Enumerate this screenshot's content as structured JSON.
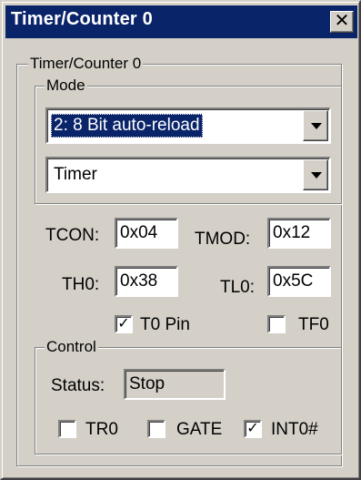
{
  "window": {
    "title": "Timer/Counter 0",
    "close_glyph": "✕"
  },
  "group_timer": {
    "legend": "Timer/Counter 0"
  },
  "group_mode": {
    "legend": "Mode",
    "mode_select": {
      "value": "2: 8 Bit auto-reload"
    },
    "type_select": {
      "value": "Timer"
    }
  },
  "registers": {
    "tcon": {
      "label": "TCON:",
      "value": "0x04"
    },
    "tmod": {
      "label": "TMOD:",
      "value": "0x12"
    },
    "th0": {
      "label": "TH0:",
      "value": "0x38"
    },
    "tl0": {
      "label": "TL0:",
      "value": "0x5C"
    }
  },
  "pins": {
    "t0_pin": {
      "label": "T0 Pin",
      "checked": true
    },
    "tf0": {
      "label": "TF0",
      "checked": false
    }
  },
  "group_control": {
    "legend": "Control",
    "status_label": "Status:",
    "status_value": "Stop",
    "tr0": {
      "label": "TR0",
      "checked": false
    },
    "gate": {
      "label": "GATE",
      "checked": false
    },
    "int0": {
      "label": "INT0#",
      "checked": true
    }
  },
  "colors": {
    "title_bar": "#0a246a",
    "dialog_face": "#d4d0c8",
    "selection": "#0a246a"
  }
}
